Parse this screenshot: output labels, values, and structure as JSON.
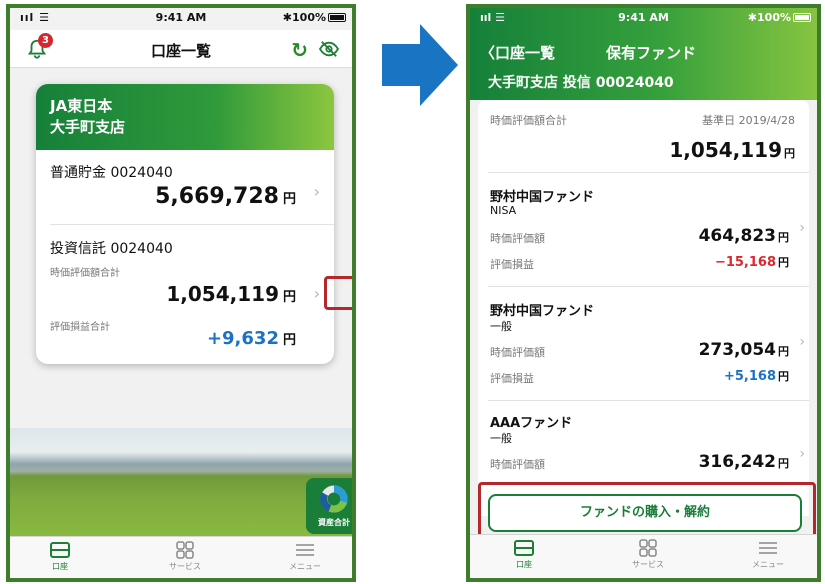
{
  "left": {
    "status": {
      "signal": "ııl ☰",
      "time": "9:41 AM",
      "battery": "✱100%"
    },
    "nav": {
      "title": "口座一覧",
      "badge": "3",
      "refresh_icon": "↻",
      "eye_icon": "eye-slash"
    },
    "card": {
      "bank": "JA東日本",
      "branch": "大手町支店",
      "savings": {
        "label": "普通貯金 0024040",
        "amount": "5,669,728",
        "unit": "円"
      },
      "trust": {
        "label": "投資信託 0024040",
        "value_label": "時価評価額合計",
        "value": "1,054,119",
        "pl_label": "評価損益合計",
        "pl": "+9,632",
        "unit": "円"
      }
    },
    "asset_button": "資産合計",
    "tabs": [
      "口座",
      "サービス",
      "メニュー"
    ]
  },
  "right": {
    "status": {
      "signal": "ııl ☰",
      "time": "9:41 AM",
      "battery": "✱100%"
    },
    "back_label": "口座一覧",
    "title": "保有ファンド",
    "branch_line": "大手町支店  投信  00024040",
    "summary": {
      "label": "時価評価額合計",
      "date_label": "基準日  2019/4/28",
      "total": "1,054,119",
      "unit": "円"
    },
    "funds": [
      {
        "name": "野村中国ファンド",
        "type": "NISA",
        "value_label": "時価評価額",
        "value": "464,823",
        "pl_label": "評価損益",
        "pl": "−15,168"
      },
      {
        "name": "野村中国ファンド",
        "type": "一般",
        "value_label": "時価評価額",
        "value": "273,054",
        "pl_label": "評価損益",
        "pl": "+5,168"
      },
      {
        "name": "AAAファンド",
        "type": "一般",
        "value_label": "時価評価額",
        "value": "316,242"
      }
    ],
    "unit": "円",
    "action_button": "ファンドの購入・解約",
    "tabs": [
      "口座",
      "サービス",
      "メニュー"
    ]
  },
  "colors": {
    "brand_green": "#1a7e39",
    "negative": "#e0242c",
    "positive": "#1b72c4",
    "highlight": "#b3272d"
  }
}
